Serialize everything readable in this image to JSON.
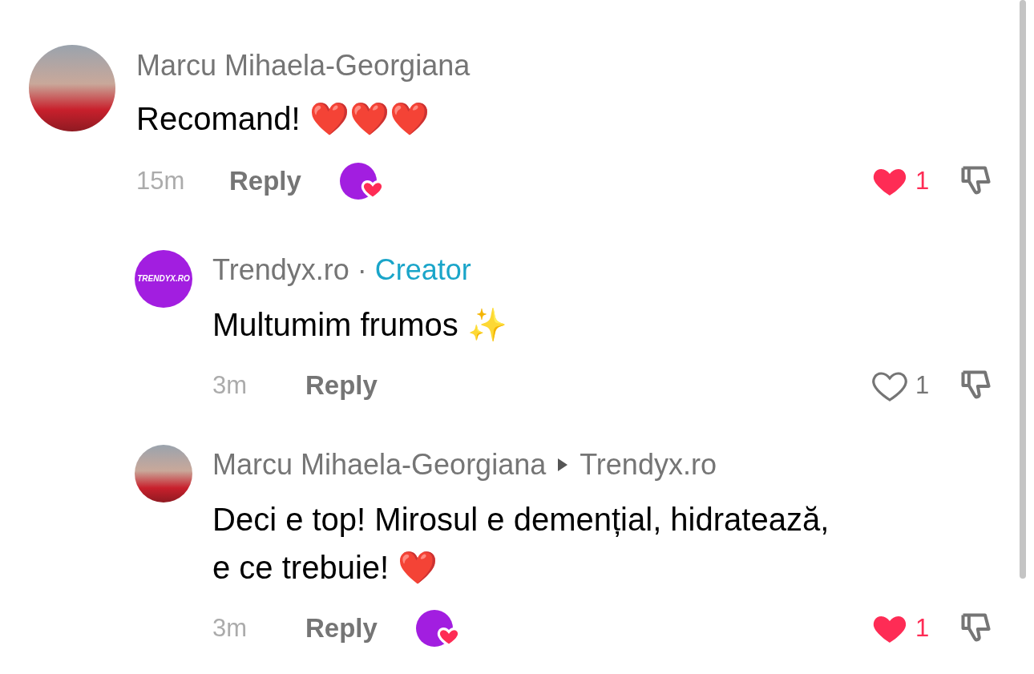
{
  "comments": [
    {
      "author": "Marcu Mihaela-Georgiana",
      "avatar": {
        "kind": "photo"
      },
      "text": "Recomand!",
      "emoji": "❤️❤️❤️",
      "time": "15m",
      "reply_label": "Reply",
      "creator_liked": true,
      "liked": true,
      "like_count": "1",
      "replies": [
        {
          "author": "Trendyx.ro",
          "separator": "·",
          "badge": "Creator",
          "avatar": {
            "kind": "logo",
            "text": "TRENDYX.RO"
          },
          "text": "Multumim frumos",
          "emoji": "✨",
          "time": "3m",
          "reply_label": "Reply",
          "creator_liked": false,
          "liked": false,
          "like_count": "1"
        },
        {
          "author": "Marcu Mihaela-Georgiana",
          "reply_to": "Trendyx.ro",
          "avatar": {
            "kind": "photo"
          },
          "text": "Deci e top! Mirosul e demențial, hidratează, e ce trebuie!",
          "emoji": "❤️",
          "time": "3m",
          "reply_label": "Reply",
          "creator_liked": true,
          "liked": true,
          "like_count": "1"
        }
      ]
    }
  ]
}
